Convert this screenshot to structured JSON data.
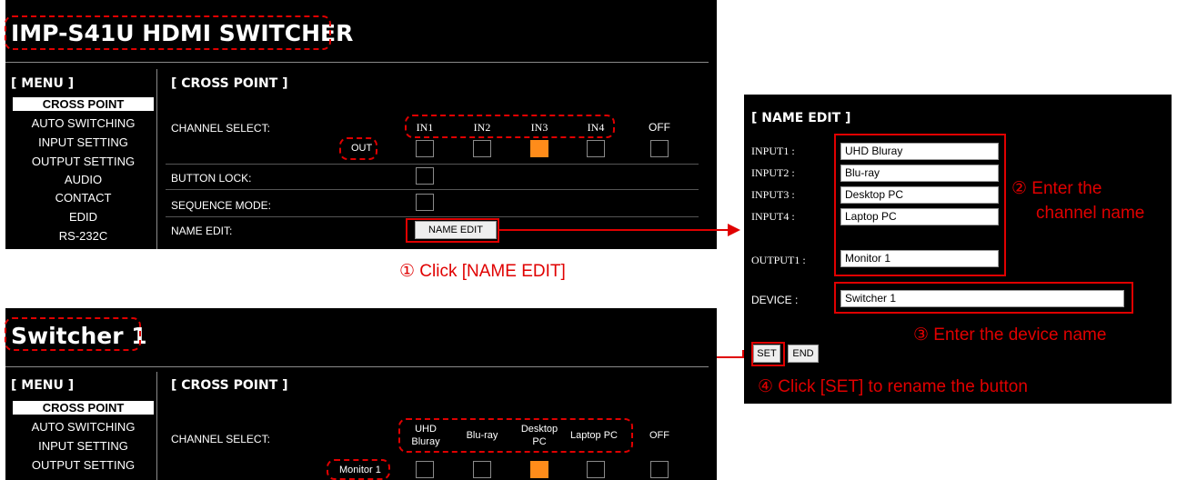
{
  "top_panel": {
    "title": "IMP-S41U HDMI SWITCHER",
    "menu_header": "[ MENU ]",
    "section_header": "[ CROSS POINT ]",
    "menu_items": [
      "CROSS POINT",
      "AUTO SWITCHING",
      "INPUT SETTING",
      "OUTPUT SETTING",
      "AUDIO",
      "CONTACT",
      "EDID",
      "RS-232C"
    ],
    "rows": {
      "channel_select": "CHANNEL SELECT:",
      "button_lock": "BUTTON LOCK:",
      "sequence_mode": "SEQUENCE MODE:",
      "name_edit": "NAME EDIT:"
    },
    "inputs": [
      "IN1",
      "IN2",
      "IN3",
      "IN4",
      "OFF"
    ],
    "out_label": "OUT",
    "selected_input": "IN3",
    "name_edit_button": "NAME EDIT"
  },
  "bottom_panel": {
    "title": "Switcher 1",
    "menu_header": "[ MENU ]",
    "section_header": "[ CROSS POINT ]",
    "menu_items": [
      "CROSS POINT",
      "AUTO SWITCHING",
      "INPUT SETTING",
      "OUTPUT SETTING"
    ],
    "channel_select": "CHANNEL SELECT:",
    "inputs": [
      [
        "UHD",
        "Bluray"
      ],
      [
        "Blu-ray"
      ],
      [
        "Desktop",
        "PC"
      ],
      [
        "Laptop PC"
      ],
      [
        "OFF"
      ]
    ],
    "out_label": "Monitor 1",
    "selected_input": "Desktop PC"
  },
  "name_edit_panel": {
    "header": "[ NAME EDIT ]",
    "inputs": [
      {
        "label": "INPUT1 :",
        "value": "UHD Bluray"
      },
      {
        "label": "INPUT2 :",
        "value": "Blu-ray"
      },
      {
        "label": "INPUT3 :",
        "value": "Desktop PC"
      },
      {
        "label": "INPUT4 :",
        "value": "Laptop PC"
      }
    ],
    "output": {
      "label": "OUTPUT1 :",
      "value": "Monitor 1"
    },
    "device": {
      "label": "DEVICE :",
      "value": "Switcher 1"
    },
    "set_button": "SET",
    "end_button": "END"
  },
  "annotations": {
    "step1": "① Click [NAME EDIT]",
    "step2_line1": "② Enter the",
    "step2_line2": "channel name",
    "step3": "③ Enter the device name",
    "step4": "④ Click [SET] to rename the button"
  },
  "colors": {
    "accent_red": "#e00000",
    "selected_orange": "#ff8c1a",
    "panel_bg": "#000000"
  }
}
